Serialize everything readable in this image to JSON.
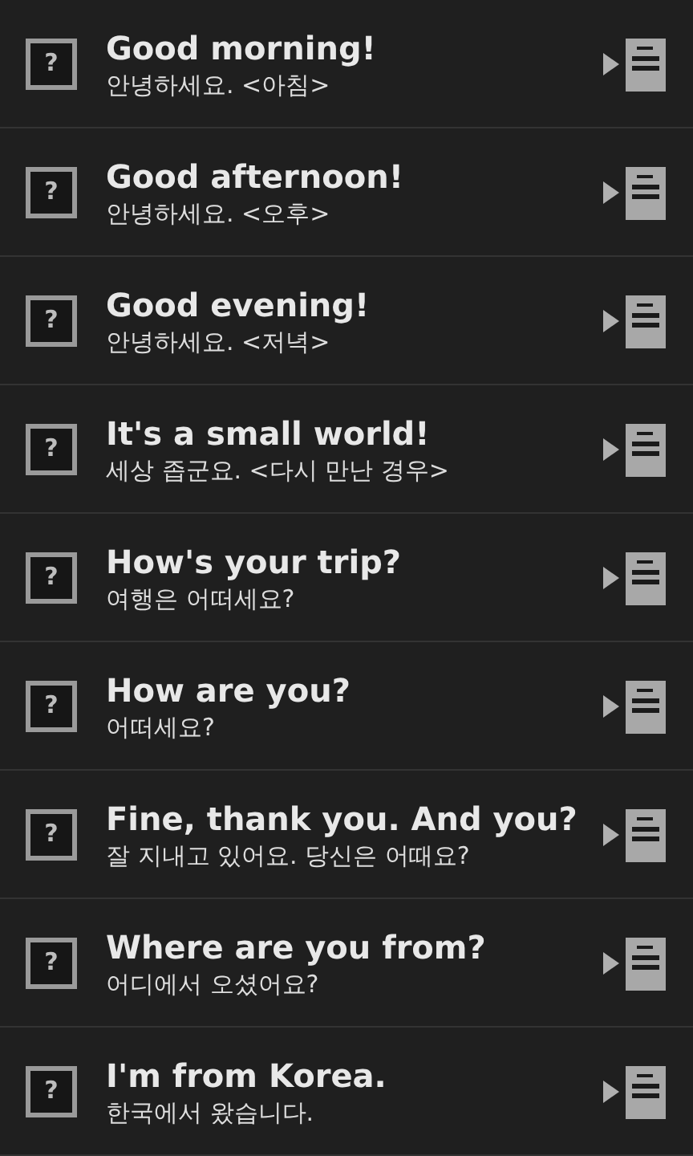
{
  "phrases": [
    {
      "mark": "?",
      "english": "Good morning!",
      "korean": "안녕하세요. <아침>"
    },
    {
      "mark": "?",
      "english": "Good afternoon!",
      "korean": "안녕하세요. <오후>"
    },
    {
      "mark": "?",
      "english": "Good evening!",
      "korean": "안녕하세요. <저녁>"
    },
    {
      "mark": "?",
      "english": "It's a small world!",
      "korean": "세상 좁군요. <다시 만난 경우>"
    },
    {
      "mark": "?",
      "english": "How's your trip?",
      "korean": "여행은 어떠세요?"
    },
    {
      "mark": "?",
      "english": "How are you?",
      "korean": "어떠세요?"
    },
    {
      "mark": "?",
      "english": "Fine, thank you. And you?",
      "korean": "잘 지내고 있어요. 당신은 어때요?"
    },
    {
      "mark": "?",
      "english": "Where are you from?",
      "korean": "어디에서 오셨어요?"
    },
    {
      "mark": "?",
      "english": "I'm from Korea.",
      "korean": "한국에서 왔습니다."
    }
  ]
}
